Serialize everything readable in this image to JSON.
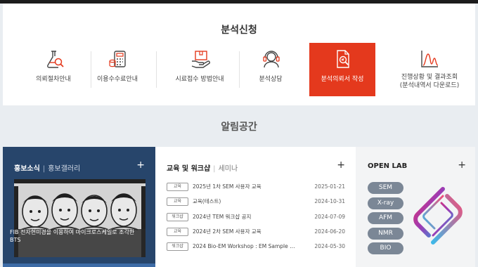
{
  "service": {
    "title": "분석신청",
    "items": [
      {
        "label": "의뢰절차안내",
        "icon": "flask-magnifier-icon"
      },
      {
        "label": "이용수수료안내",
        "icon": "calculator-coins-icon"
      },
      {
        "label": "시료접수 방법안내",
        "icon": "box-hand-icon"
      },
      {
        "label": "분석상담",
        "icon": "headset-icon"
      },
      {
        "label": "분석의뢰서 작성",
        "icon": "document-search-icon"
      },
      {
        "label": "진행상황 및 결과조회",
        "label2": "(분석내역서 다운로드)",
        "icon": "spectrum-chart-icon"
      }
    ],
    "active_index": 4
  },
  "notice": {
    "title": "알림공간"
  },
  "promo": {
    "tab_main": "홍보소식",
    "separator": "|",
    "tab_sub": "홍보갤러리",
    "plus": "+",
    "caption": "FIB 전자현미경을 이용하여 마이크로스케일로 조각한 BTS"
  },
  "edu": {
    "tab_main": "교육 및 워크샵",
    "separator": "|",
    "tab_sub": "세미나",
    "plus": "+",
    "items": [
      {
        "badge": "교육",
        "text": "2025년 1차 SEM 사용자 교육",
        "date": "2025-01-21"
      },
      {
        "badge": "교육",
        "text": "교육(테스트)",
        "date": "2024-10-31"
      },
      {
        "badge": "워크샵",
        "text": "2024년 TEM 워크샵 공지",
        "date": "2024-07-09"
      },
      {
        "badge": "교육",
        "text": "2024년 2차 SEM 사용자 교육",
        "date": "2024-06-20"
      },
      {
        "badge": "워크샵",
        "text": "2024 Bio-EM Workshop : EM Sample Pre...",
        "date": "2024-05-30"
      }
    ]
  },
  "lab": {
    "title": "OPEN LAB",
    "plus": "+",
    "pills": [
      "SEM",
      "X-ray",
      "AFM",
      "NMR",
      "BIO"
    ]
  },
  "colors": {
    "accent": "#e4391d",
    "promo_bg": "#27456b",
    "pill": "#7b8796"
  }
}
